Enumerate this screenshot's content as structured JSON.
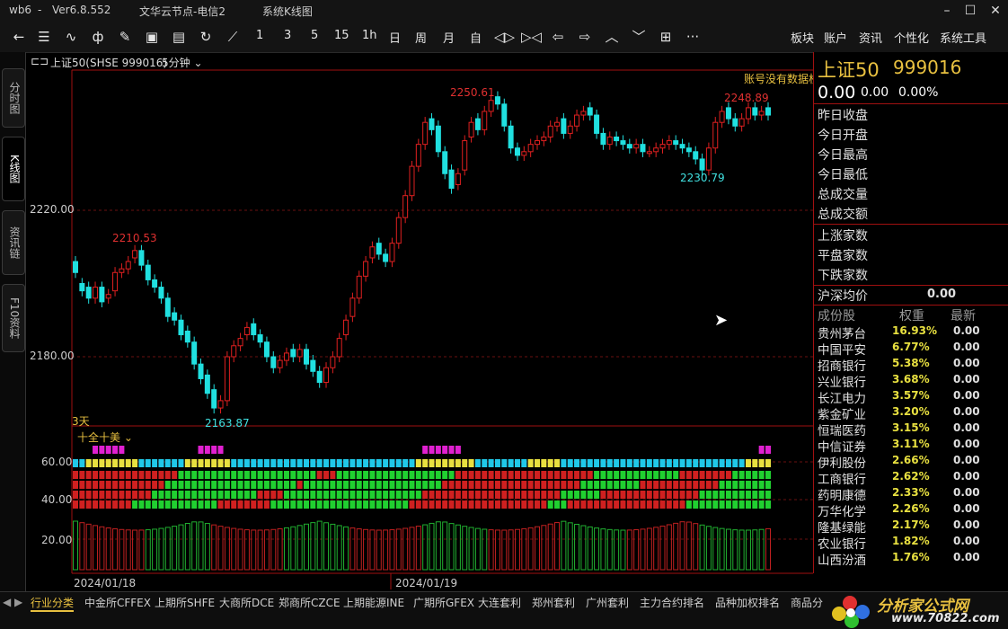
{
  "window": {
    "app_id": "wb6",
    "version": "Ver6.8.552",
    "server": "文华云节点-电信2",
    "mode": "系统K线图"
  },
  "toolbar": {
    "menu_items": [
      "板块",
      "账户",
      "资讯",
      "个性化",
      "系统工具"
    ],
    "periods": [
      "1",
      "3",
      "5",
      "15",
      "1h",
      "日",
      "周",
      "月",
      "自"
    ]
  },
  "left_tabs": [
    "分时图",
    "K线图",
    "资讯链",
    "F10资料"
  ],
  "chart_header": {
    "title": "上证50(SHSE 999016)",
    "period": "5分钟",
    "notice": "账号没有数据权限",
    "days_label": "3天",
    "indicator_name": "十全十美"
  },
  "chart_data": {
    "type": "candlestick",
    "y_ticks": [
      "2220.00",
      "2180.00"
    ],
    "sub_y_ticks": [
      "60.00",
      "40.00",
      "20.00"
    ],
    "x_labels": [
      "2024/01/18",
      "2024/01/19"
    ],
    "annotations": [
      {
        "text": "2210.53",
        "kind": "high"
      },
      {
        "text": "2163.87",
        "kind": "low"
      },
      {
        "text": "2250.61",
        "kind": "high"
      },
      {
        "text": "2248.89",
        "kind": "high"
      },
      {
        "text": "2230.79",
        "kind": "low"
      }
    ],
    "close": [
      2203,
      2198,
      2196,
      2199,
      2195,
      2197,
      2203,
      2204,
      2206,
      2209,
      2205,
      2201,
      2199,
      2196,
      2191,
      2190,
      2186,
      2184,
      2178,
      2174,
      2170,
      2166,
      2168,
      2180,
      2183,
      2185,
      2188,
      2186,
      2184,
      2180,
      2177,
      2179,
      2181,
      2180,
      2182,
      2178,
      2176,
      2173,
      2177,
      2180,
      2185,
      2190,
      2196,
      2202,
      2206,
      2210,
      2208,
      2206,
      2211,
      2218,
      2224,
      2232,
      2238,
      2244,
      2242,
      2236,
      2230,
      2226,
      2230,
      2239,
      2244,
      2242,
      2247,
      2250,
      2249,
      2243,
      2237,
      2235,
      2236,
      2238,
      2239,
      2240,
      2243,
      2244,
      2241,
      2243,
      2246,
      2247,
      2246,
      2241,
      2238,
      2240,
      2239,
      2238,
      2237,
      2238,
      2236,
      2236,
      2237,
      2238,
      2239,
      2238,
      2237,
      2236,
      2234,
      2231,
      2237,
      2244,
      2247,
      2245,
      2243,
      2245,
      2248,
      2246,
      2247,
      2246
    ],
    "open": [
      2206,
      2200,
      2199,
      2196,
      2199,
      2196,
      2198,
      2203,
      2204,
      2207,
      2209,
      2205,
      2201,
      2199,
      2196,
      2192,
      2190,
      2187,
      2184,
      2178,
      2175,
      2171,
      2166,
      2168,
      2180,
      2183,
      2186,
      2189,
      2186,
      2184,
      2180,
      2177,
      2179,
      2182,
      2180,
      2182,
      2179,
      2176,
      2173,
      2177,
      2180,
      2186,
      2191,
      2196,
      2202,
      2207,
      2211,
      2208,
      2206,
      2211,
      2218,
      2224,
      2232,
      2238,
      2245,
      2243,
      2236,
      2231,
      2227,
      2231,
      2240,
      2245,
      2242,
      2247,
      2251,
      2249,
      2243,
      2237,
      2235,
      2236,
      2238,
      2239,
      2240,
      2243,
      2245,
      2241,
      2243,
      2246,
      2248,
      2246,
      2241,
      2238,
      2240,
      2239,
      2238,
      2237,
      2238,
      2236,
      2236,
      2237,
      2238,
      2239,
      2238,
      2237,
      2236,
      2234,
      2231,
      2237,
      2244,
      2248,
      2245,
      2243,
      2245,
      2248,
      2246,
      2248
    ]
  },
  "right_panel": {
    "title": "上证50",
    "code": "999016",
    "price": "0.00",
    "change": "0.00",
    "change_pct": "0.00%",
    "fields": [
      "昨日收盘",
      "今日开盘",
      "今日最高",
      "今日最低",
      "总成交量",
      "总成交额"
    ],
    "breadth": [
      "上涨家数",
      "平盘家数",
      "下跌家数"
    ],
    "avg_label": "沪深均价",
    "avg_value": "0.00",
    "table_headers": [
      "成份股",
      "权重",
      "最新"
    ],
    "stocks": [
      {
        "name": "贵州茅台",
        "weight": "16.93%",
        "last": "0.00"
      },
      {
        "name": "中国平安",
        "weight": "6.77%",
        "last": "0.00"
      },
      {
        "name": "招商银行",
        "weight": "5.38%",
        "last": "0.00"
      },
      {
        "name": "兴业银行",
        "weight": "3.68%",
        "last": "0.00"
      },
      {
        "name": "长江电力",
        "weight": "3.57%",
        "last": "0.00"
      },
      {
        "name": "紫金矿业",
        "weight": "3.20%",
        "last": "0.00"
      },
      {
        "name": "恒瑞医药",
        "weight": "3.15%",
        "last": "0.00"
      },
      {
        "name": "中信证券",
        "weight": "3.11%",
        "last": "0.00"
      },
      {
        "name": "伊利股份",
        "weight": "2.66%",
        "last": "0.00"
      },
      {
        "name": "工商银行",
        "weight": "2.62%",
        "last": "0.00"
      },
      {
        "name": "药明康德",
        "weight": "2.33%",
        "last": "0.00"
      },
      {
        "name": "万华化学",
        "weight": "2.26%",
        "last": "0.00"
      },
      {
        "name": "隆基绿能",
        "weight": "2.17%",
        "last": "0.00"
      },
      {
        "name": "农业银行",
        "weight": "1.82%",
        "last": "0.00"
      },
      {
        "name": "山西汾酒",
        "weight": "1.76%",
        "last": "0.00"
      }
    ]
  },
  "bottom_tabs": [
    "行业分类",
    "中金所CFFEX",
    "上期所SHFE",
    "大商所DCE",
    "郑商所CZCE",
    "上期能源INE",
    "广期所GFEX",
    "大连套利",
    "郑州套利",
    "广州套利",
    "主力合约排名",
    "品种加权排名",
    "商品分"
  ],
  "logo": {
    "text": "分析家公式网",
    "url_text": "www.70822.com"
  },
  "colors": {
    "up": "#e02020",
    "down": "#20e0e0",
    "accent": "#e8c040",
    "magenta": "#e020d0",
    "green": "#20d020"
  }
}
